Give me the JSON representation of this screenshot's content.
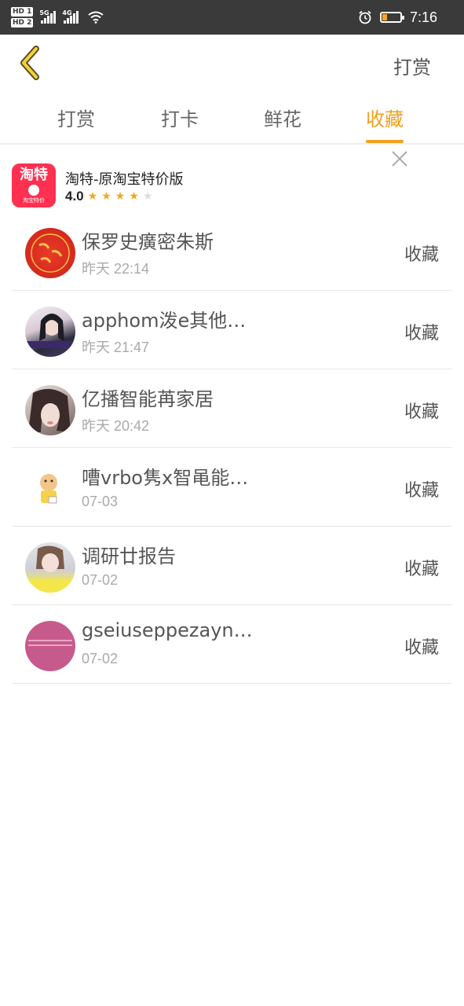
{
  "status_bar": {
    "sim1": "HD 1",
    "sim2": "HD 2",
    "net1": "5G",
    "net2": "4G",
    "time": "7:16"
  },
  "header": {
    "action_label": "打赏"
  },
  "tabs": [
    {
      "label": "打赏",
      "active": false
    },
    {
      "label": "打卡",
      "active": false
    },
    {
      "label": "鲜花",
      "active": false
    },
    {
      "label": "收藏",
      "active": true
    }
  ],
  "ad": {
    "icon_text_big": "淘特",
    "icon_text_small": "淘宝特价",
    "title": "淘特-原淘宝特价版",
    "rating": "4.0",
    "stars_filled": 4,
    "stars_total": 5
  },
  "list": [
    {
      "name": "保罗史癀密朱斯",
      "time": "昨天 22:14",
      "action": "收藏"
    },
    {
      "name": "apphom泼e其他…",
      "time": "昨天 21:47",
      "action": "收藏"
    },
    {
      "name": "亿播智能苒家居",
      "time": "昨天 20:42",
      "action": "收藏"
    },
    {
      "name": "嘈vrbo隽x智黾能…",
      "time": "07-03",
      "action": "收藏"
    },
    {
      "name": "调研廿报告",
      "time": "07-02",
      "action": "收藏"
    },
    {
      "name": "gseiuseppezayn…",
      "time": "07-02",
      "action": "收藏"
    }
  ],
  "colors": {
    "accent": "#f0a020",
    "status_bar_bg": "#3a3a3a",
    "ad_icon_bg": "#ff3050"
  }
}
